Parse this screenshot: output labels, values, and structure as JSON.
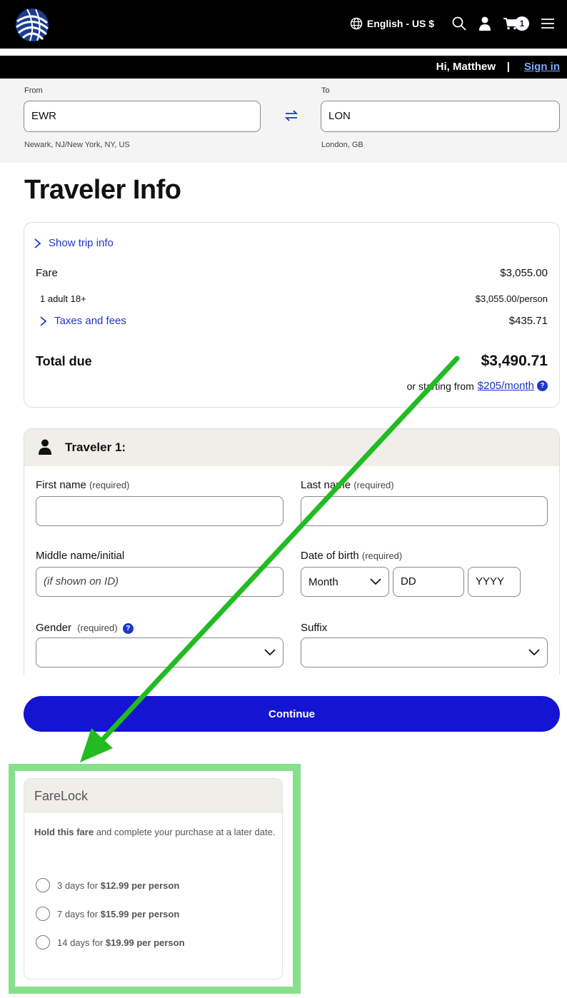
{
  "header": {
    "language": "English - US $",
    "cart_count": "1",
    "greeting": "Hi, Matthew",
    "separator": "|",
    "sign_in": "Sign in"
  },
  "route": {
    "from_label": "From",
    "from_value": "EWR",
    "from_sub": "Newark, NJ/New York, NY, US",
    "to_label": "To",
    "to_value": "LON",
    "to_sub": "London, GB"
  },
  "page_title": "Traveler Info",
  "fare_summary": {
    "show_trip_info": "Show trip info",
    "fare_label": "Fare",
    "fare_value": "$3,055.00",
    "adult_label": "1 adult 18+",
    "adult_value": "$3,055.00/person",
    "taxes_label": "Taxes and fees",
    "taxes_value": "$435.71",
    "total_label": "Total due",
    "total_value": "$3,490.71",
    "monthly_prefix": "or starting from",
    "monthly_link": "$205/month"
  },
  "traveler": {
    "heading": "Traveler 1:",
    "first_name_label": "First name",
    "last_name_label": "Last name",
    "required": "(required)",
    "middle_label": "Middle name/initial",
    "middle_placeholder": "(if shown on ID)",
    "dob_label": "Date of birth",
    "dob_month": "Month",
    "dob_day": "DD",
    "dob_year": "YYYY",
    "gender_label": "Gender",
    "suffix_label": "Suffix"
  },
  "continue_label": "Continue",
  "farelock": {
    "title": "FareLock",
    "desc_bold": "Hold this fare",
    "desc_rest": " and complete your purchase at a later date.",
    "options": [
      {
        "days": "3 days for ",
        "price": "$12.99 per person"
      },
      {
        "days": "7 days for ",
        "price": "$15.99 per person"
      },
      {
        "days": "14 days for ",
        "price": "$19.99 per person"
      }
    ]
  },
  "colors": {
    "brand_blue": "#1414d2",
    "link_blue": "#1d36c9",
    "highlight_green": "#86e08a",
    "arrow_green": "#22bb22"
  }
}
